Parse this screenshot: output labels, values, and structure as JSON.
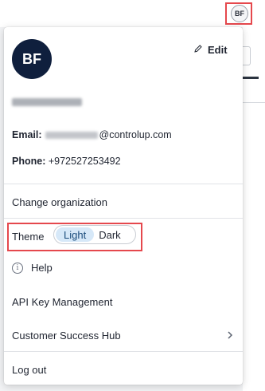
{
  "header": {
    "avatar_initials": "BF"
  },
  "profile": {
    "initials": "BF",
    "edit_label": "Edit",
    "email_label": "Email:",
    "email_value": "@controlup.com",
    "phone_label": "Phone:",
    "phone_value": "+972527253492"
  },
  "menu": {
    "change_org": "Change organization",
    "theme_label": "Theme",
    "theme_options": [
      "Light",
      "Dark"
    ],
    "theme_selected": "Light",
    "help": "Help",
    "api_keys": "API Key Management",
    "customer_hub": "Customer Success Hub",
    "logout": "Log out"
  },
  "icons": {
    "edit": "pencil-icon",
    "help": "info-icon",
    "submenu": "chevron-right-icon"
  },
  "colors": {
    "avatar_bg": "#0f1f3d",
    "highlight": "#e5484d",
    "theme_active_bg": "#d6e8f8"
  }
}
